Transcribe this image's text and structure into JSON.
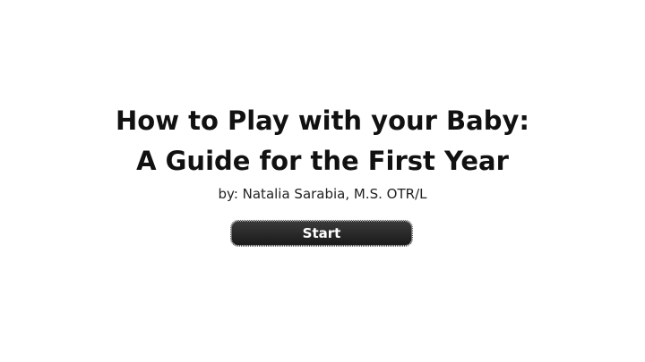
{
  "title": {
    "line1": "How to Play with your Baby:",
    "line2": "A Guide for the First Year"
  },
  "byline": "by: Natalia Sarabia, M.S. OTR/L",
  "start_button": {
    "label": "Start"
  },
  "colors": {
    "background": "#ffffff",
    "title_text": "#111111",
    "button_bg": "#2a2a2a",
    "button_text": "#ffffff"
  }
}
